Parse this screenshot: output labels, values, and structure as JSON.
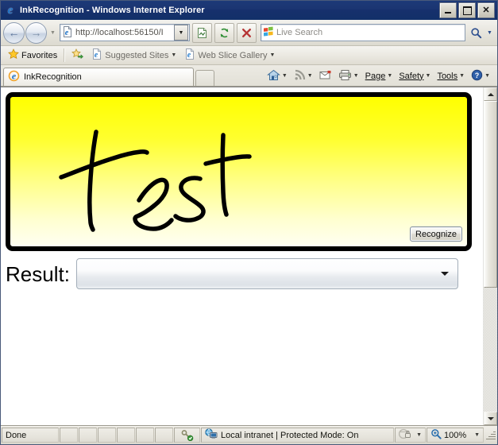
{
  "window": {
    "title": "InkRecognition - Windows Internet Explorer",
    "app_icon": "ie-logo-icon",
    "minimize_label": "Minimize",
    "maximize_label": "Maximize",
    "close_label": "Close"
  },
  "nav": {
    "back_label": "Back",
    "forward_label": "Forward",
    "history_caret": "▼",
    "address": {
      "url_scheme": "http://",
      "url_rest": "localhost:56150/I",
      "url_full": "http://localhost:56150/I",
      "favicon": "ie-page-icon",
      "dropdown_caret": "▼"
    },
    "compat_button": "compatibility-view-icon",
    "refresh_button": "refresh-icon",
    "stop_button": "stop-icon",
    "search": {
      "provider_icon": "live-search-icon",
      "placeholder": "Live Search",
      "value": "",
      "go_label": "Search",
      "caret": "▼"
    }
  },
  "favorites_bar": {
    "favorites_label": "Favorites",
    "add_to_favorites_icon": "add-favorites-icon",
    "items": [
      {
        "label": "Suggested Sites",
        "icon": "ie-page-icon",
        "caret": "▼"
      },
      {
        "label": "Web Slice Gallery",
        "icon": "ie-page-icon",
        "caret": "▼"
      }
    ]
  },
  "tabs": {
    "list": [
      {
        "label": "InkRecognition",
        "icon": "ie-page-icon",
        "active": true
      }
    ],
    "new_tab_label": ""
  },
  "command_bar": {
    "home_label": "Home",
    "feeds_label": "Feeds",
    "mail_label": "Read Mail",
    "print_label": "Print",
    "items": [
      {
        "label": "Page",
        "accesskey": "P",
        "caret": "▼"
      },
      {
        "label": "Safety",
        "accesskey": "S",
        "caret": "▼"
      },
      {
        "label": "Tools",
        "accesskey": "o",
        "caret": "▼"
      }
    ],
    "help_label": "Help",
    "help_caret": "▼"
  },
  "page": {
    "ink_canvas": {
      "name": "ink-canvas",
      "handwriting_text": "test",
      "background_top_color": "#ffff00",
      "background_bottom_color": "#fffff2",
      "stroke_color": "#000000",
      "border_color": "#000000"
    },
    "recognize_button_label": "Recognize",
    "result_label": "Result:",
    "result_combo": {
      "value": "",
      "options": [],
      "caret": "▼"
    }
  },
  "scrollbar": {
    "up_label": "Scroll up",
    "down_label": "Scroll down",
    "thumb_position_percent": 0
  },
  "status_bar": {
    "status_text": "Done",
    "security_icon": "protected-mode-key-icon",
    "zone_icon": "local-intranet-icon",
    "zone_text": "Local intranet | Protected Mode: On",
    "privacy_icon": "privacy-report-icon",
    "privacy_caret": "▼",
    "zoom_icon": "zoom-magnifier-icon",
    "zoom_level": "100%",
    "zoom_caret": "▼"
  }
}
